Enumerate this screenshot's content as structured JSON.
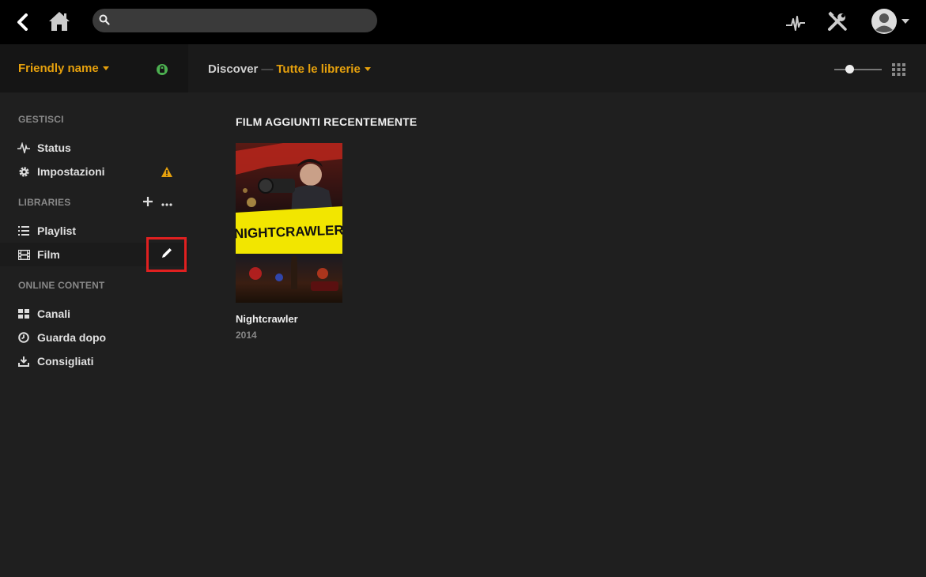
{
  "topbar": {
    "search_placeholder": "",
    "icons": [
      "back-arrow-icon",
      "home-icon",
      "search-icon",
      "activity-icon",
      "tools-icon",
      "user-avatar-icon"
    ]
  },
  "sidebar": {
    "server_name": "Friendly name",
    "sections": {
      "manage": "GESTISCI",
      "libraries": "LIBRARIES",
      "online": "ONLINE CONTENT"
    },
    "items": [
      {
        "label": "Status",
        "icon": "activity-icon"
      },
      {
        "label": "Impostazioni",
        "icon": "gear-icon"
      },
      {
        "label": "Playlist",
        "icon": "list-icon"
      },
      {
        "label": "Film",
        "icon": "film-icon"
      },
      {
        "label": "Canali",
        "icon": "grid-icon"
      },
      {
        "label": "Guarda dopo",
        "icon": "clock-icon"
      },
      {
        "label": "Consigliati",
        "icon": "download-icon"
      }
    ]
  },
  "header": {
    "discover": "Discover",
    "separator": "—",
    "library": "Tutte le librerie"
  },
  "main": {
    "section_title": "FILM AGGIUNTI RECENTEMENTE",
    "movies": [
      {
        "title": "Nightcrawler",
        "year": "2014",
        "poster_text": "NIGHTCRAWLER"
      }
    ]
  },
  "colors": {
    "accent": "#e5a00d",
    "lock": "#4caf50",
    "warning": "#e5a00d",
    "highlight": "#e02020"
  }
}
